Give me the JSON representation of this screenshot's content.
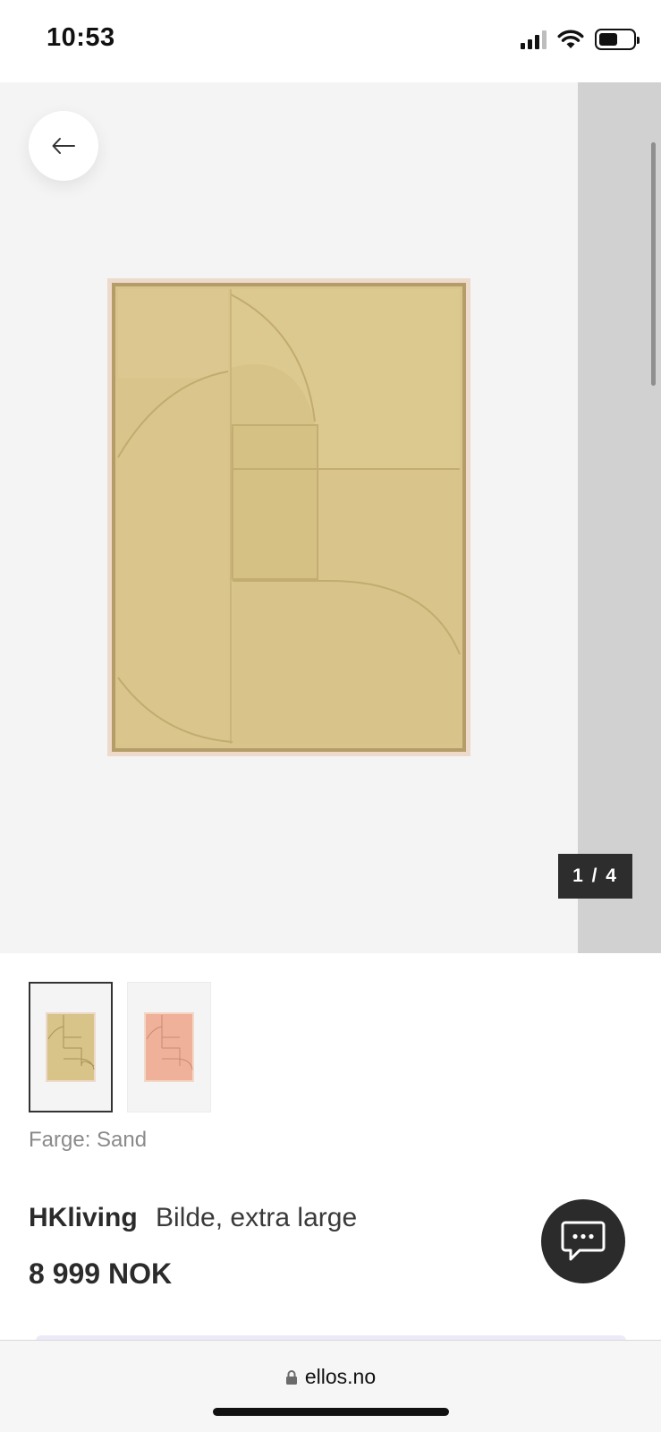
{
  "status_bar": {
    "time": "10:53",
    "icons": [
      "cellular-signal-icon",
      "wifi-icon",
      "battery-icon"
    ]
  },
  "gallery": {
    "back_icon": "arrow-left-icon",
    "counter": "1 / 4",
    "image": "framed-relief-artwork-sand"
  },
  "thumbnails": [
    {
      "name": "sand",
      "color": "#d9c48b",
      "selected": true
    },
    {
      "name": "pink",
      "color": "#f0b09a",
      "selected": false
    }
  ],
  "product": {
    "color_label": "Farge: Sand",
    "brand": "HKliving",
    "name": "Bilde, extra large",
    "price": "8 999 NOK"
  },
  "chat": {
    "icon": "chat-bubble-icon"
  },
  "browser": {
    "lock_icon": "lock-icon",
    "url": "ellos.no"
  },
  "colors": {
    "sand": "#dcc98f",
    "sand_dark": "#c9b473",
    "frame": "#ecd7c8",
    "gallery_bg": "#f4f4f4",
    "counter_bg": "#2d2d2d"
  }
}
